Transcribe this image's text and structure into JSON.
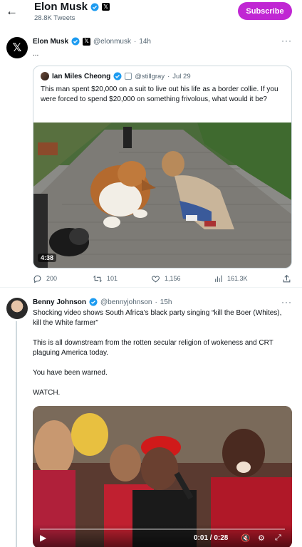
{
  "header": {
    "back_icon": "arrow-left-icon",
    "name": "Elon Musk",
    "subtitle": "28.8K Tweets",
    "subscribe_label": "Subscribe",
    "subscribe_color": "#c026d3"
  },
  "tweet1": {
    "author_name": "Elon Musk",
    "handle": "@elonmusk",
    "time": "14h",
    "text": "...",
    "more": "···",
    "quote": {
      "author_name": "Ian Miles Cheong",
      "handle": "@stillgray",
      "date": "Jul 29",
      "text": "This man spent $20,000 on a suit to live out his life as a border collie. If you were forced to spend $20,000 on something frivolous, what would it be?",
      "video_duration": "4:38"
    },
    "actions": {
      "replies": "200",
      "retweets": "101",
      "likes": "1,156",
      "views": "161.3K"
    }
  },
  "tweet2": {
    "author_name": "Benny Johnson",
    "handle": "@bennyjohnson",
    "time": "15h",
    "more": "···",
    "paragraphs": [
      "Shocking video shows South Africa’s black party singing “kill the Boer (Whites), kill the White farmer”",
      "This is all downstream from the rotten secular religion of wokeness and CRT plaguing America today.",
      "You have been warned.",
      "WATCH."
    ],
    "video": {
      "time": "0:01 / 0:28"
    }
  },
  "colors": {
    "accent_blue": "#1d9bf0",
    "text_primary": "#0f1419",
    "text_secondary": "#536471",
    "border": "#cfd9de"
  }
}
